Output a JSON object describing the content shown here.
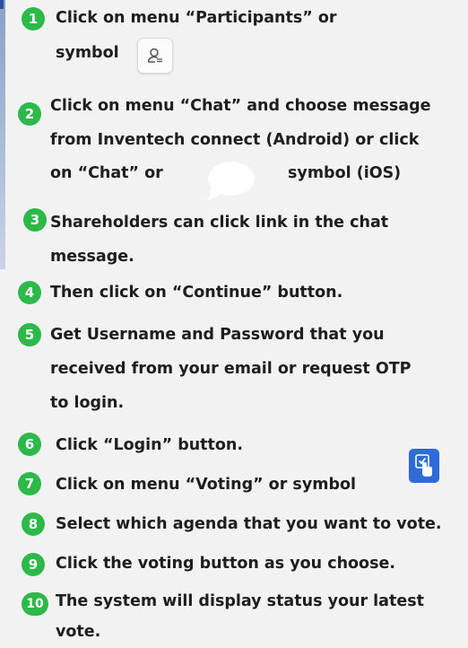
{
  "steps": [
    {
      "num": "1",
      "lines": [
        "Click on menu “Participants” or",
        "symbol"
      ]
    },
    {
      "num": "2",
      "lines": [
        "Click on menu “Chat” and choose message",
        "from Inventech connect (Android) or click",
        "on “Chat” or",
        "symbol (iOS)"
      ]
    },
    {
      "num": "3",
      "lines": [
        "Shareholders can click link in the chat",
        "message."
      ]
    },
    {
      "num": "4",
      "lines": [
        "Then click on “Continue” button."
      ]
    },
    {
      "num": "5",
      "lines": [
        "Get Username and Password that you",
        "received from your email or request OTP",
        "to login."
      ]
    },
    {
      "num": "6",
      "lines": [
        "Click “Login” button."
      ]
    },
    {
      "num": "7",
      "lines": [
        "Click on menu “Voting” or symbol"
      ]
    },
    {
      "num": "8",
      "lines": [
        "Select which agenda that you want to vote."
      ]
    },
    {
      "num": "9",
      "lines": [
        "Click the voting button as you choose."
      ]
    },
    {
      "num": "10",
      "lines": [
        "The system will display status your latest",
        "vote."
      ]
    }
  ],
  "icons": {
    "participants": "participants-icon",
    "chat": "chat-bubble-icon",
    "voting": "voting-hand-icon"
  },
  "colors": {
    "badge": "#2db84a",
    "background": "#f2f2f2",
    "voting_icon": "#2f6bd8"
  }
}
